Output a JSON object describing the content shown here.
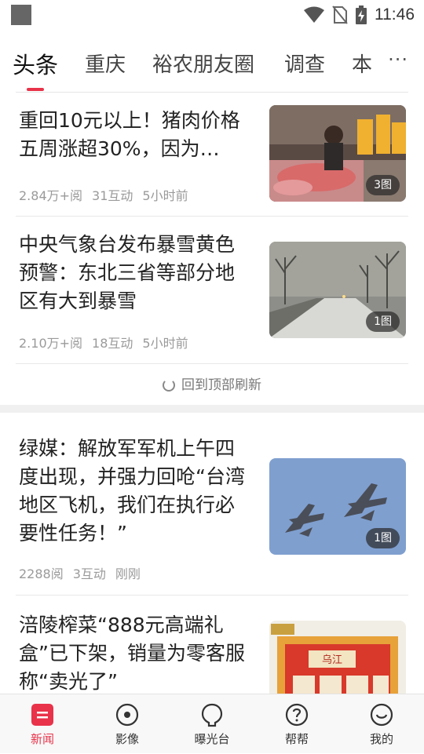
{
  "status_bar": {
    "time": "11:46"
  },
  "tabs": {
    "items": [
      "头条",
      "重庆",
      "裕农朋友圈",
      "调查",
      "本"
    ],
    "more": "···",
    "active_color": "#e8334a"
  },
  "articles": [
    {
      "title": "重回10元以上！猪肉价格五周涨超30%，因为…",
      "views": "2.84万+阅",
      "interactions": "31互动",
      "time": "5小时前",
      "image_badge": "3图"
    },
    {
      "title": "中央气象台发布暴雪黄色预警：东北三省等部分地区有大到暴雪",
      "views": "2.10万+阅",
      "interactions": "18互动",
      "time": "5小时前",
      "image_badge": "1图"
    },
    {
      "title": "绿媒：解放军军机上午四度出现，并强力回呛“台湾地区飞机，我们在执行必要性任务！”",
      "views": "2288阅",
      "interactions": "3互动",
      "time": "刚刚",
      "image_badge": "1图"
    },
    {
      "title": "涪陵榨菜“888元高端礼盒”已下架，销量为零客服称“卖光了”",
      "views": "",
      "interactions": "",
      "time": "",
      "image_badge": "",
      "image_text": "乌江"
    }
  ],
  "refresh": {
    "label": "回到顶部刷新"
  },
  "bottom_nav": {
    "items": [
      "新闻",
      "影像",
      "曝光台",
      "帮帮",
      "我的"
    ],
    "active_index": 0
  }
}
